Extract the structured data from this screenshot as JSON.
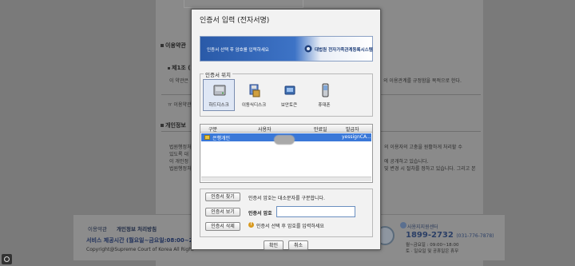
{
  "background_page": {
    "section_terms": "이용약관",
    "article_1": "제1조 (",
    "terms_text": "이 약관은",
    "terms_text_right": "의 이용관계를 규정함을 목적으로 한다.",
    "prev_terms": "ㅠ 이용약관",
    "section_privacy": "개인정보",
    "privacy_lines": [
      "법원행정처",
      "있도록 대",
      "이 개인정",
      "법원행정처"
    ],
    "privacy_lines_right": [
      "의 이용자의 고충을 원활하게 처리할 수",
      "에 공개하고 있습니다.",
      "",
      "및 변경 시 절차를 정하고 있습니다. 그리고 본"
    ],
    "privacy_tail": [
      "수",
      "",
      "",
      "본"
    ],
    "footer_nav": [
      "이용약관",
      "개인정보 처리방침"
    ],
    "footer_service": "서비스 제공시간 (월요일~금요일:08:00~2",
    "footer_copy": "Copyright@Supreme Court of Korea All Right",
    "center_name": "사용지지원센터",
    "center_phone": "1899-2732",
    "center_phone_alt": "(031-776-7878)",
    "center_hours_1": "월~금요일 : 09:00~18:00",
    "center_hours_2": "토 · 일요일 및 공휴일은 휴무"
  },
  "dialog": {
    "title": "인증서 입력 (전자서명)",
    "banner_text": "인증서 선택 후 암호를 입력하세요",
    "banner_org": "대법원 전자가족관계등록시스템",
    "location_legend": "인증서 위치",
    "locations": [
      {
        "label": "하드디스크",
        "icon": "hard-disk-icon",
        "selected": true
      },
      {
        "label": "이동식디스크",
        "icon": "removable-disk-icon",
        "selected": false
      },
      {
        "label": "보안토큰",
        "icon": "security-token-icon",
        "selected": false
      },
      {
        "label": "휴대폰",
        "icon": "mobile-phone-icon",
        "selected": false
      }
    ],
    "table": {
      "columns": [
        "구분",
        "사용자",
        "만료일",
        "발급자"
      ],
      "rows": [
        {
          "type": "은행개인",
          "user": "",
          "expiry": "",
          "issuer": "yessignCA..."
        }
      ]
    },
    "buttons": {
      "find": "인증서 찾기",
      "view": "인증서 보기",
      "delete": "인증서 삭제",
      "ok": "확인",
      "cancel": "취소"
    },
    "note_case_sensitive": "인증서 암호는 대소문자를 구분합니다.",
    "password_label": "인증서 암호",
    "password_value": "",
    "warning_text": "인증서 선택 후 암호를 입력하세요"
  },
  "colors": {
    "selected_row": "#3a78d8",
    "banner_blue": "#2a5aa8",
    "overlay": "#7a7a7a"
  }
}
